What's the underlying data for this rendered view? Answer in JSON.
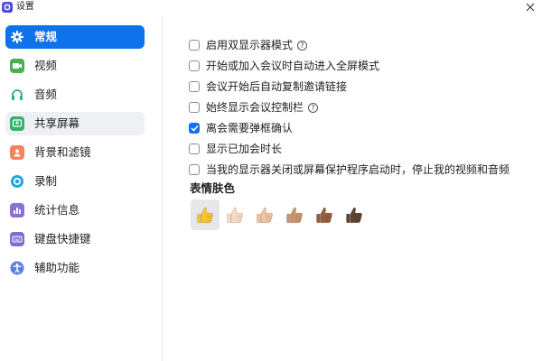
{
  "window": {
    "title": "设置",
    "close_glyph": "✕",
    "logo_icon": "zoom-logo-icon",
    "accent_color": "#0e72ed"
  },
  "sidebar": {
    "items": [
      {
        "label": "常规",
        "icon": "gear-icon",
        "icon_color": "#ffffff",
        "active": true
      },
      {
        "label": "视频",
        "icon": "video-camera-icon",
        "icon_color": "#4caf50"
      },
      {
        "label": "音频",
        "icon": "headphones-icon",
        "icon_color": "#2db36b"
      },
      {
        "label": "共享屏幕",
        "icon": "share-screen-icon",
        "icon_color": "#2db36b",
        "hover": true
      },
      {
        "label": "背景和滤镜",
        "icon": "person-background-icon",
        "icon_color": "#f5845e"
      },
      {
        "label": "录制",
        "icon": "record-icon",
        "icon_color": "#22a6e0"
      },
      {
        "label": "统计信息",
        "icon": "statistics-icon",
        "icon_color": "#8b6fd6"
      },
      {
        "label": "键盘快捷键",
        "icon": "keyboard-icon",
        "icon_color": "#7b6fd6"
      },
      {
        "label": "辅助功能",
        "icon": "accessibility-icon",
        "icon_color": "#5b7fe0"
      }
    ]
  },
  "general": {
    "options": [
      {
        "label": "启用双显示器模式",
        "checked": false,
        "help": true
      },
      {
        "label": "开始或加入会议时自动进入全屏模式",
        "checked": false
      },
      {
        "label": "会议开始后自动复制邀请链接",
        "checked": false
      },
      {
        "label": "始终显示会议控制栏",
        "checked": false,
        "help": true
      },
      {
        "label": "离会需要弹框确认",
        "checked": true
      },
      {
        "label": "显示已加会时长",
        "checked": false
      },
      {
        "label": "当我的显示器关闭或屏幕保护程序启动时，停止我的视频和音频",
        "checked": false
      }
    ],
    "help_glyph": "?",
    "emoji_section_title": "表情肤色",
    "skin_tones": [
      {
        "name": "default-yellow",
        "color": "#f7c530",
        "selected": true
      },
      {
        "name": "light",
        "color": "#f6dcc4"
      },
      {
        "name": "medium-light",
        "color": "#efc4a0"
      },
      {
        "name": "medium",
        "color": "#c8946e"
      },
      {
        "name": "medium-dark",
        "color": "#93603f"
      },
      {
        "name": "dark",
        "color": "#5d4334"
      }
    ]
  }
}
